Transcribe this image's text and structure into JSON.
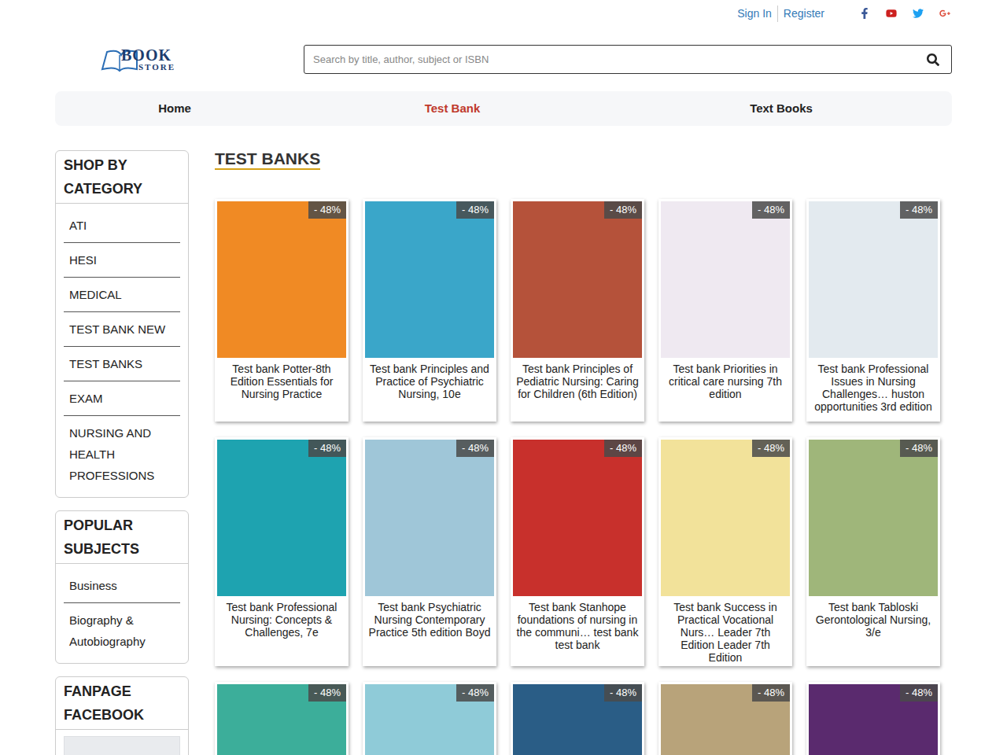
{
  "top_bar": {
    "links": [
      "Sign In",
      "Register"
    ]
  },
  "logo": {
    "line1": "BOOK",
    "line2": "STORE"
  },
  "search": {
    "placeholder": "Search by title, author, subject or ISBN"
  },
  "nav": [
    {
      "label": "Home",
      "selected": false
    },
    {
      "label": "Test Bank",
      "selected": true
    },
    {
      "label": "Text Books",
      "selected": false
    }
  ],
  "sidebar": [
    {
      "title": "SHOP BY CATEGORY",
      "items": [
        "ATI",
        "HESI",
        "MEDICAL",
        "TEST BANK NEW",
        "TEST BANKS",
        "EXAM",
        "NURSING AND HEALTH PROFESSIONS"
      ]
    },
    {
      "title": "POPULAR SUBJECTS",
      "items": [
        "Business",
        "Biography & Autobiography"
      ]
    },
    {
      "title": "FANPAGE FACEBOOK",
      "items": []
    }
  ],
  "page_title": "TEST BANKS",
  "products": [
    {
      "title": "Test bank Potter-8th Edition Essentials for Nursing Practice",
      "badge": "- 48%",
      "color": "#f08a24"
    },
    {
      "title": "Test bank Principles and Practice of Psychiatric Nursing, 10e",
      "badge": "- 48%",
      "color": "#3aa6c9"
    },
    {
      "title": "Test bank Principles of Pediatric Nursing: Caring for Children (6th Edition)",
      "badge": "- 48%",
      "color": "#b5523a"
    },
    {
      "title": "Test bank Priorities in critical care nursing 7th edition",
      "badge": "- 48%",
      "color": "#efe9f1"
    },
    {
      "title": "Test bank Professional Issues in Nursing Challenges… huston opportunities 3rd edition",
      "badge": "- 48%",
      "color": "#e3eaef"
    },
    {
      "title": "Test bank Professional Nursing: Concepts & Challenges, 7e",
      "badge": "- 48%",
      "color": "#1ea3b0"
    },
    {
      "title": "Test bank Psychiatric Nursing Contemporary Practice 5th edition Boyd",
      "badge": "- 48%",
      "color": "#9fc6d8"
    },
    {
      "title": "Test bank Stanhope foundations of nursing in the communi… test bank test bank",
      "badge": "- 48%",
      "color": "#c8302c"
    },
    {
      "title": "Test bank Success in Practical Vocational Nurs… Leader 7th Edition Leader 7th Edition",
      "badge": "- 48%",
      "color": "#f2e29a"
    },
    {
      "title": "Test bank Tabloski Gerontological Nursing, 3/e",
      "badge": "- 48%",
      "color": "#9fb67a"
    },
    {
      "title": "",
      "badge": "- 48%",
      "color": "#3cae9a"
    },
    {
      "title": "",
      "badge": "- 48%",
      "color": "#8fcbd8"
    },
    {
      "title": "",
      "badge": "- 48%",
      "color": "#2a5d86"
    },
    {
      "title": "",
      "badge": "- 48%",
      "color": "#b8a37a"
    },
    {
      "title": "",
      "badge": "- 48%",
      "color": "#5a2a6e"
    }
  ]
}
